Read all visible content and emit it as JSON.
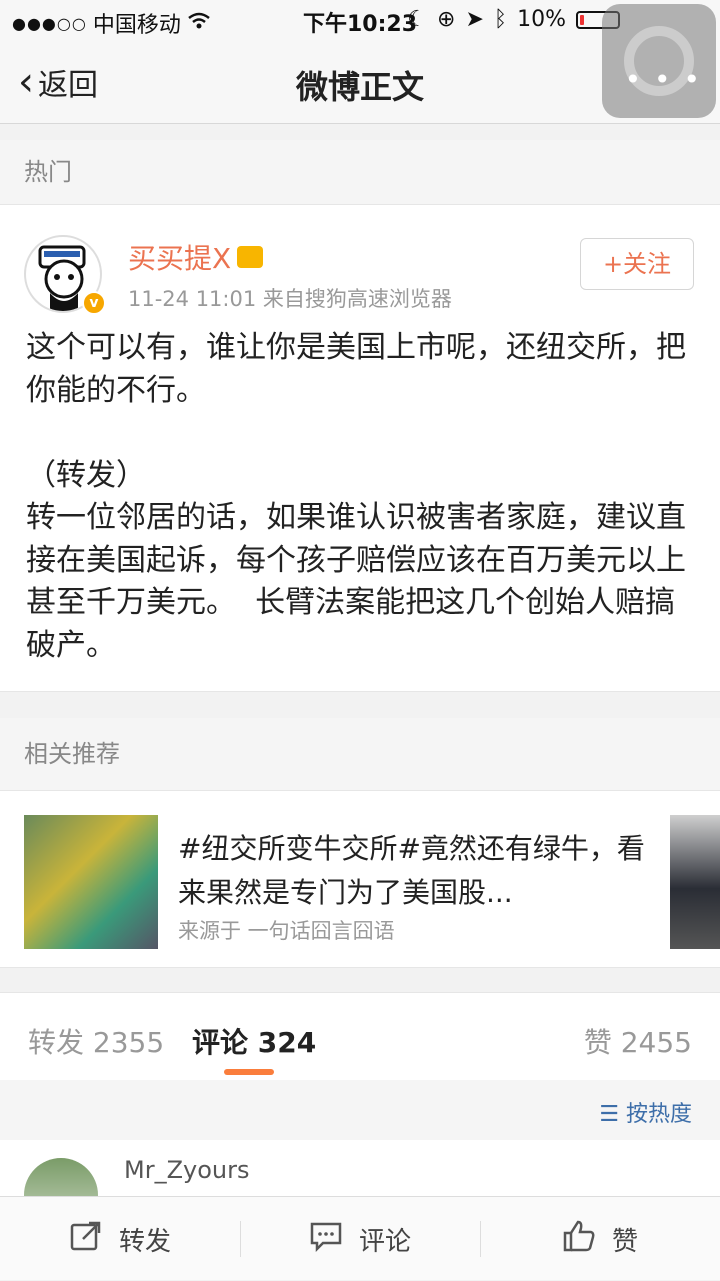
{
  "statusbar": {
    "signal": "●●●○○",
    "carrier": "中国移动",
    "time": "下午10:23",
    "battery": "10%",
    "battery_level": 0.1
  },
  "navbar": {
    "back_label": "返回",
    "title": "微博正文"
  },
  "hot_label": "热门",
  "post": {
    "username": "买买提X",
    "meta": "11-24 11:01  来自搜狗高速浏览器",
    "follow_label": "+关注",
    "content": "这个可以有，谁让你是美国上市呢，还纽交所，把你能的不行。\n\n（转发）\n转一位邻居的话，如果谁认识被害者家庭，建议直接在美国起诉，每个孩子赔偿应该在百万美元以上甚至千万美元。  长臂法案能把这几个创始人赔搞破产。"
  },
  "related_label": "相关推荐",
  "recommend": {
    "title": "#纽交所变牛交所#竟然还有绿牛，看来果然是专门为了美国股...",
    "source": "来源于 一句话囧言囧语"
  },
  "tabs": [
    {
      "label": "转发 2355"
    },
    {
      "label": "评论 324"
    },
    {
      "label": "赞 2455"
    }
  ],
  "sort_label": "按热度",
  "comment": {
    "name": "Mr_Zyours"
  },
  "toolbar": {
    "repost": "转发",
    "comment": "评论",
    "like": "赞"
  },
  "colors": {
    "accent_orange": "#eb7350",
    "tab_underline": "#fa7d3c",
    "link_blue": "#3d6ea9"
  }
}
